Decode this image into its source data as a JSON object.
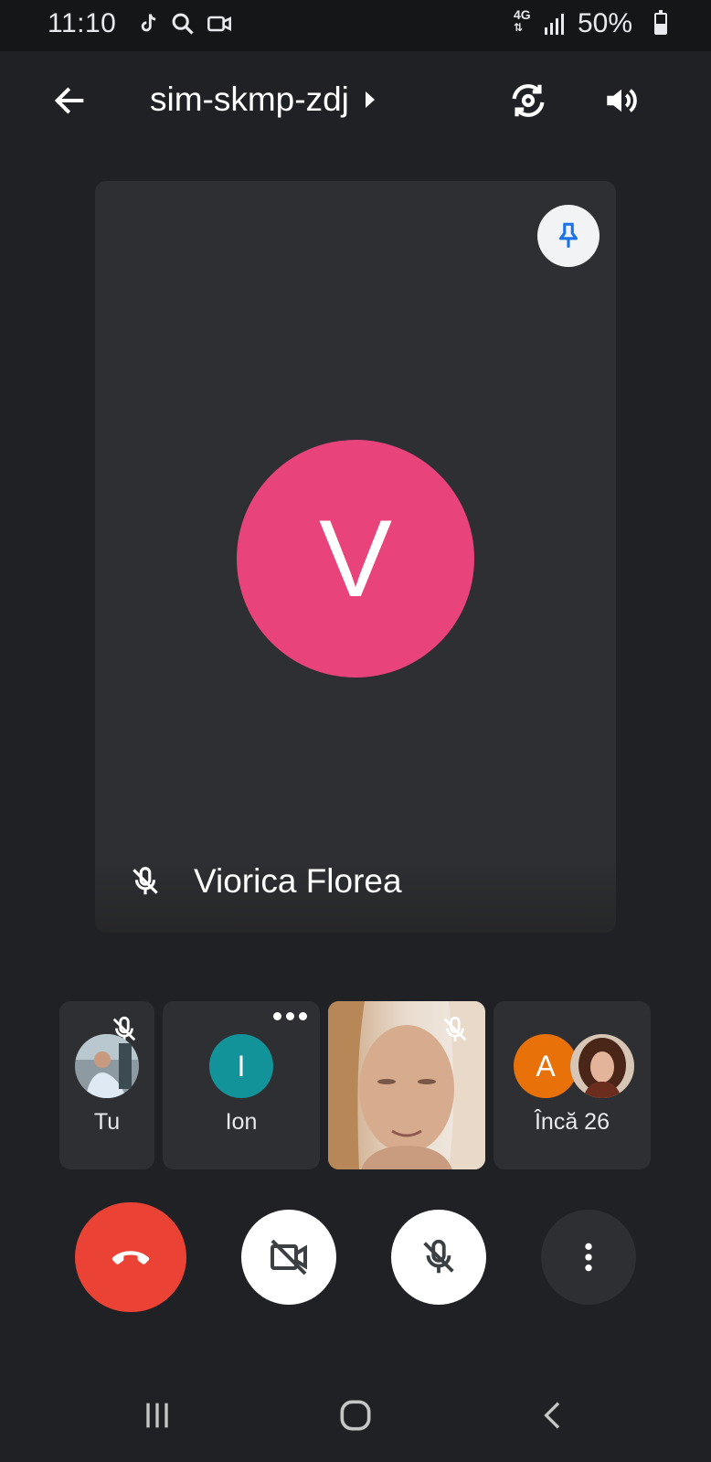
{
  "status_bar": {
    "time": "11:10",
    "network": "4G",
    "battery": "50%",
    "battery_level": 0.5
  },
  "header": {
    "meeting_code": "sim-skmp-zdj"
  },
  "main_tile": {
    "avatar_letter": "V",
    "avatar_color": "#e8437a",
    "participant_name": "Viorica Florea"
  },
  "participants": [
    {
      "name": "Tu",
      "muted": true
    },
    {
      "name": "Ion",
      "avatar_letter": "I",
      "avatar_color": "#12939a"
    },
    {
      "name": "",
      "muted": true
    },
    {
      "name": "Încă 26",
      "avatar_letter": "A",
      "avatar_color": "#e8710a"
    }
  ],
  "controls": {
    "hangup_color": "#ea4335"
  }
}
